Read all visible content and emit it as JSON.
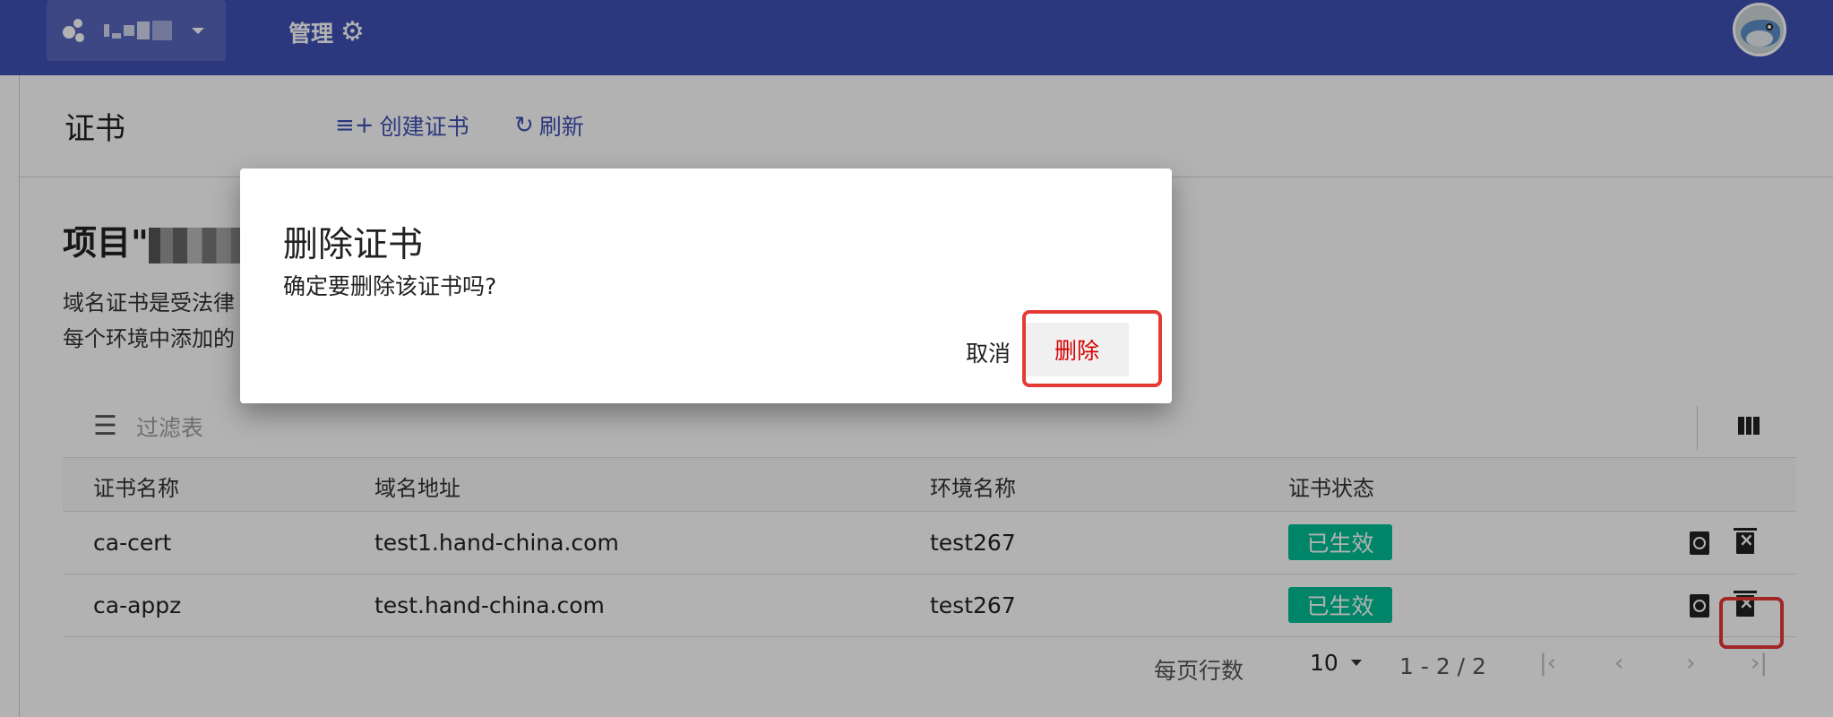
{
  "header": {
    "project_selector_blurred": true,
    "admin_label": "管理",
    "admin_icon": "gear-icon",
    "avatar_icon": "avatar-icon"
  },
  "page": {
    "title": "证书",
    "create_label": "创建证书",
    "refresh_label": "刷新"
  },
  "section": {
    "title_prefix": "项目\"",
    "desc_line1": "域名证书是受法律",
    "desc_line2": "每个环境中添加的"
  },
  "table": {
    "filter_placeholder": "过滤表",
    "columns": [
      "证书名称",
      "域名地址",
      "环境名称",
      "证书状态"
    ],
    "rows": [
      {
        "name": "ca-cert",
        "domain": "test1.hand-china.com",
        "env": "test267",
        "status": "已生效"
      },
      {
        "name": "ca-appz",
        "domain": "test.hand-china.com",
        "env": "test267",
        "status": "已生效"
      }
    ],
    "status_color": "#00bf96"
  },
  "pager": {
    "rows_per_page_label": "每页行数",
    "rows_per_page": "10",
    "range": "1 - 2 / 2"
  },
  "dialog": {
    "title": "删除证书",
    "message": "确定要删除该证书吗?",
    "cancel_label": "取消",
    "delete_label": "删除",
    "highlight_color": "#e53935"
  },
  "theme": {
    "primary": "#3f51b5",
    "danger": "#d50000"
  }
}
